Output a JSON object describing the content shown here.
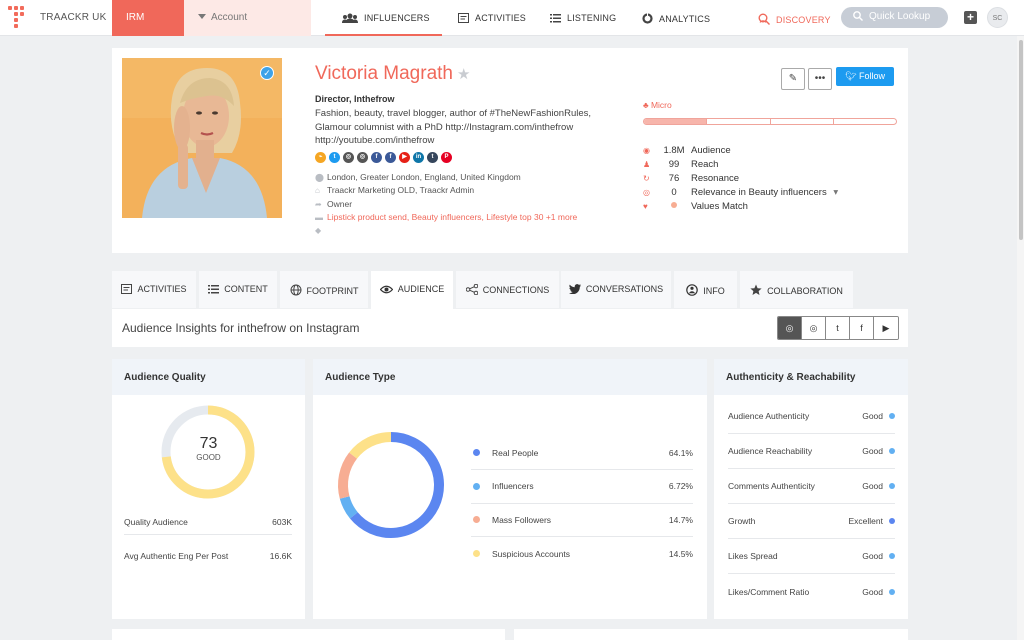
{
  "colors": {
    "accent": "#f0685a",
    "twitter": "#1d9bf0",
    "real_people": "#5b86f0",
    "influencers": "#62b0f2",
    "mass_followers": "#f7ad93",
    "suspicious": "#fde189",
    "quality_ring": "#fde189"
  },
  "nav": {
    "logo_text": "TRAACKR UK",
    "irm": "IRM",
    "account": "Account",
    "tabs": [
      "INFLUENCERS",
      "ACTIVITIES",
      "LISTENING",
      "ANALYTICS"
    ],
    "discovery": "DISCOVERY",
    "quick_lookup": "Quick Lookup",
    "user_initials": "SC"
  },
  "profile": {
    "name": "Victoria Magrath",
    "title": "Director, Inthefrow",
    "bio": "Fashion, beauty, travel blogger, author of #TheNewFashionRules, Glamour columnist with a PhD http://Instagram.com/inthefrow http://youtube.com/inthefrow",
    "socials": [
      {
        "icon": "rss-icon",
        "glyph": "⌁",
        "color": "#f5a623"
      },
      {
        "icon": "twitter-icon",
        "glyph": "t",
        "color": "#1d9bf0"
      },
      {
        "icon": "instagram-icon",
        "glyph": "◎",
        "color": "#555555"
      },
      {
        "icon": "instagram-alt-icon",
        "glyph": "◎",
        "color": "#555555"
      },
      {
        "icon": "facebook-icon",
        "glyph": "f",
        "color": "#3b5998"
      },
      {
        "icon": "facebook-page-icon",
        "glyph": "f",
        "color": "#3b5998"
      },
      {
        "icon": "youtube-icon",
        "glyph": "▶",
        "color": "#e62117"
      },
      {
        "icon": "linkedin-icon",
        "glyph": "in",
        "color": "#0e76a8"
      },
      {
        "icon": "tumblr-icon",
        "glyph": "t",
        "color": "#35465c"
      },
      {
        "icon": "pinterest-icon",
        "glyph": "P",
        "color": "#e60023"
      }
    ],
    "location": "London, Greater London, England, United Kingdom",
    "account_owner": "Traackr Marketing OLD, Traackr Admin",
    "role": "Owner",
    "tags": [
      "Lipstick product send",
      "Beauty influencers",
      "Lifestyle top 30"
    ],
    "tags_more": "+1 more",
    "follow_label": "Follow",
    "tier": "Micro",
    "stats": [
      {
        "value": "1.8M",
        "label": "Audience",
        "icon": "eye-icon",
        "glyph": "◉"
      },
      {
        "value": "99",
        "label": "Reach",
        "icon": "people-icon",
        "glyph": "♟"
      },
      {
        "value": "76",
        "label": "Resonance",
        "icon": "refresh-icon",
        "glyph": "↻"
      },
      {
        "value": "0",
        "label": "Relevance in Beauty influencers",
        "icon": "target-icon",
        "glyph": "◎"
      },
      {
        "value": "",
        "label": "Values Match",
        "icon": "heart-icon",
        "glyph": "♥"
      }
    ]
  },
  "subtabs": [
    "ACTIVITIES",
    "CONTENT",
    "FOOTPRINT",
    "AUDIENCE",
    "CONNECTIONS",
    "CONVERSATIONS",
    "INFO",
    "COLLABORATION"
  ],
  "insights": {
    "title": "Audience Insights for inthefrow on Instagram"
  },
  "quality": {
    "heading": "Audience Quality",
    "score": "73",
    "score_percent": 73,
    "score_label": "GOOD",
    "rows": [
      {
        "label": "Quality Audience",
        "value": "603K"
      },
      {
        "label": "Avg Authentic Eng Per Post",
        "value": "16.6K"
      }
    ]
  },
  "audience_type": {
    "heading": "Audience Type",
    "rows": [
      {
        "label": "Real People",
        "value": "64.1%",
        "color": "#5b86f0"
      },
      {
        "label": "Influencers",
        "value": "6.72%",
        "color": "#62b0f2"
      },
      {
        "label": "Mass Followers",
        "value": "14.7%",
        "color": "#f7ad93"
      },
      {
        "label": "Suspicious Accounts",
        "value": "14.5%",
        "color": "#fde189"
      }
    ]
  },
  "chart_data": {
    "type": "pie",
    "categories": [
      "Real People",
      "Influencers",
      "Mass Followers",
      "Suspicious Accounts"
    ],
    "values": [
      64.1,
      6.72,
      14.7,
      14.5
    ],
    "title": "Audience Type"
  },
  "authenticity": {
    "heading": "Authenticity & Reachability",
    "rows": [
      {
        "label": "Audience Authenticity",
        "value": "Good",
        "color": "#62b0f2"
      },
      {
        "label": "Audience Reachability",
        "value": "Good",
        "color": "#62b0f2"
      },
      {
        "label": "Comments Authenticity",
        "value": "Good",
        "color": "#62b0f2"
      },
      {
        "label": "Growth",
        "value": "Excellent",
        "color": "#5b86f0"
      },
      {
        "label": "Likes Spread",
        "value": "Good",
        "color": "#62b0f2"
      },
      {
        "label": "Likes/Comment Ratio",
        "value": "Good",
        "color": "#62b0f2"
      }
    ]
  }
}
